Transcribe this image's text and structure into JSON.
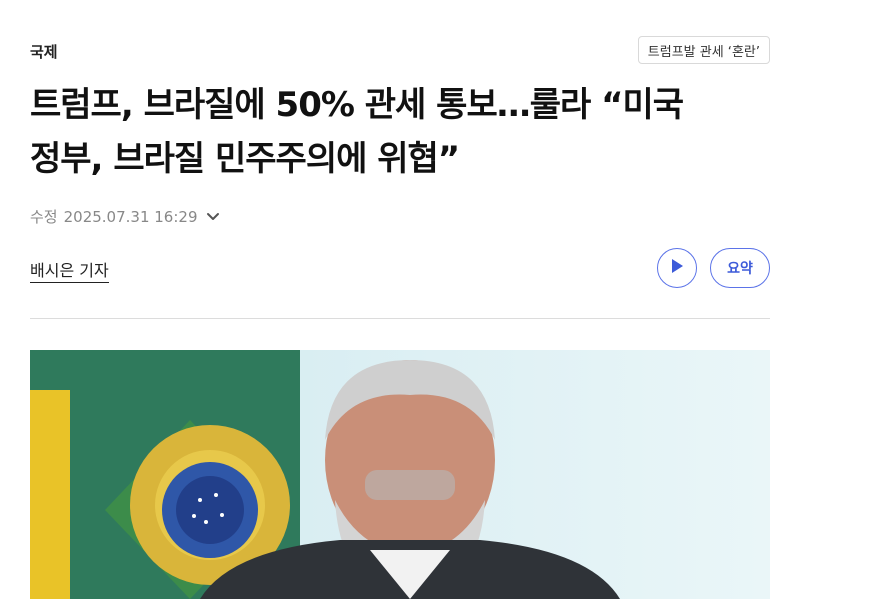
{
  "article": {
    "section": "국제",
    "topic_tag": "트럼프발 관세 ‘혼란’",
    "headline_line1": "트럼프, 브라질에 50% 관세 통보…룰라 “미국",
    "headline_line2": "정부, 브라질 민주주의에 위협”",
    "meta_label": "수정",
    "timestamp": "2025.07.31 16:29",
    "reporter": "배시은 기자",
    "summary_label": "요약"
  },
  "colors": {
    "accent": "#5b73e8",
    "text": "#111111",
    "muted": "#888888"
  },
  "icons": {
    "play": "play-icon",
    "chevron": "chevron-down-icon"
  }
}
